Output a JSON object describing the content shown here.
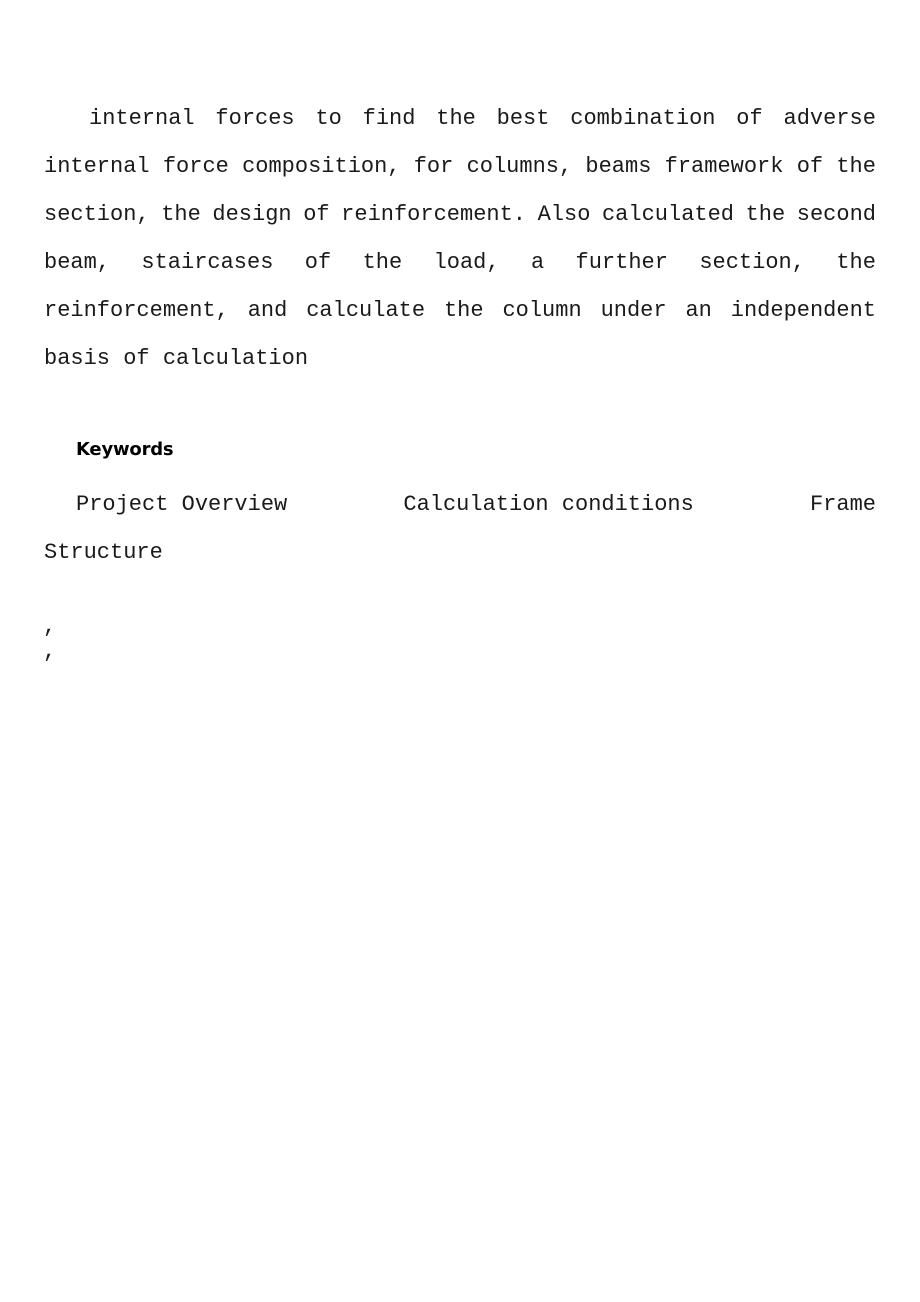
{
  "document": {
    "background_color": "#ffffff",
    "text_color": "#1a1a1a",
    "abstract": {
      "lines": [
        {
          "id": "line-1",
          "text": "internal forces to find the best combination of adverse",
          "words": [
            "internal",
            "forces",
            "to",
            "find",
            "the",
            "best",
            "combination",
            "of",
            "adverse"
          ],
          "indented": true,
          "justified": true
        },
        {
          "id": "line-2",
          "text": "internal force composition, for columns, beams framework of the",
          "words": [
            "internal",
            "force",
            "composition,",
            "for",
            "columns,",
            "beams",
            "framework",
            "of",
            "the"
          ],
          "indented": false,
          "justified": true
        },
        {
          "id": "line-3",
          "text": "section, the design of reinforcement. Also calculated the second",
          "words": [
            "section,",
            "the",
            "design",
            "of",
            "reinforcement.",
            "Also",
            "calculated",
            "the",
            "second"
          ],
          "indented": false,
          "justified": true
        },
        {
          "id": "line-4",
          "text": "beam, staircases of the load, a further section, the",
          "words": [
            "beam,",
            "staircases",
            "of",
            "the",
            "load,",
            "a",
            "further",
            "section,",
            "the"
          ],
          "indented": false,
          "justified": true
        },
        {
          "id": "line-5",
          "text": "reinforcement, and calculate the column under an independent",
          "words": [
            "reinforcement,",
            "and",
            "calculate",
            "the",
            "column",
            "under",
            "an",
            "independent"
          ],
          "indented": false,
          "justified": true
        },
        {
          "id": "line-6",
          "text": "basis of calculation",
          "words": [
            "basis",
            "of",
            "calculation"
          ],
          "indented": false,
          "justified": false
        }
      ]
    },
    "keywords_section": {
      "heading": "Keywords",
      "terms": [
        "Project Overview",
        "Calculation conditions",
        "Frame"
      ],
      "continuation": "Structure"
    },
    "stray_marks": [
      {
        "id": "stray-comma-1",
        "glyph": ","
      },
      {
        "id": "stray-comma-2",
        "glyph": ","
      }
    ]
  }
}
